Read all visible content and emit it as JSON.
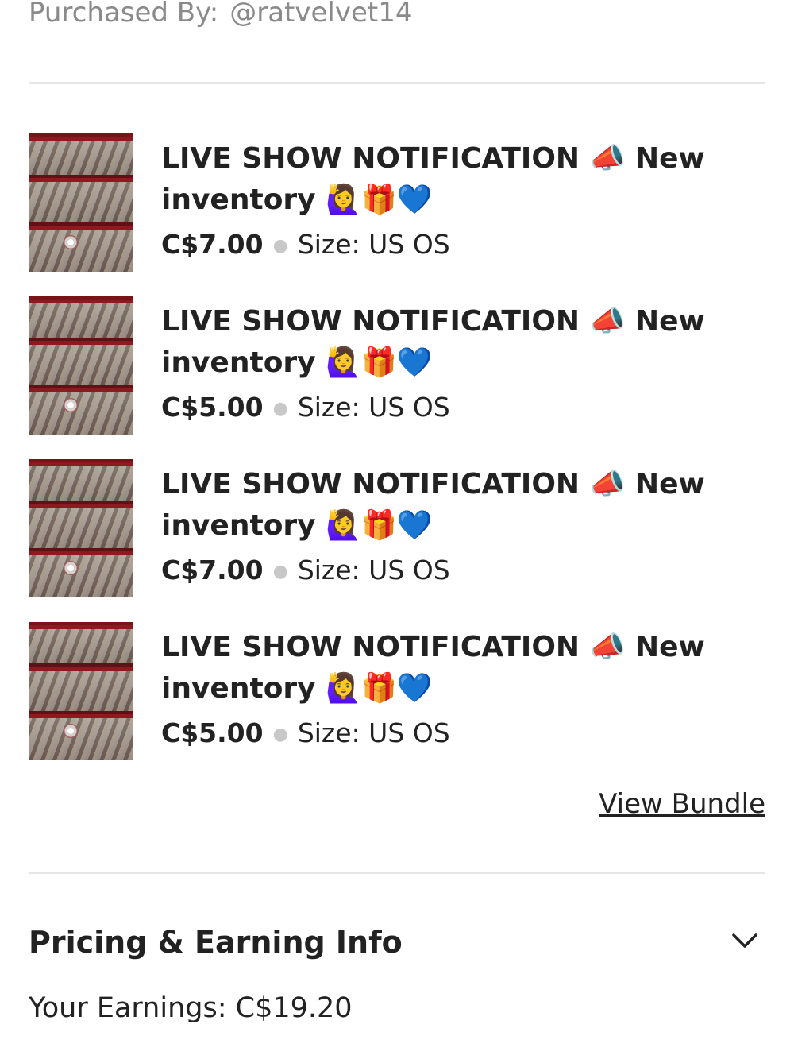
{
  "header": {
    "purchased_by_label": "Purchased By:",
    "purchased_by_user": "@ratvelvet14"
  },
  "items": [
    {
      "title": "LIVE SHOW NOTIFICATION",
      "title_emoji": "📣",
      "title_rest": "New inventory",
      "title_emojis_end": "🙋‍♀️🎁💙",
      "price": "C$7.00",
      "size": "Size: US OS"
    },
    {
      "title": "LIVE SHOW NOTIFICATION",
      "title_emoji": "📣",
      "title_rest": "New inventory",
      "title_emojis_end": "🙋‍♀️🎁💙",
      "price": "C$5.00",
      "size": "Size: US OS"
    },
    {
      "title": "LIVE SHOW NOTIFICATION",
      "title_emoji": "📣",
      "title_rest": "New inventory",
      "title_emojis_end": "🙋‍♀️🎁💙",
      "price": "C$7.00",
      "size": "Size: US OS"
    },
    {
      "title": "LIVE SHOW NOTIFICATION",
      "title_emoji": "📣",
      "title_rest": "New inventory",
      "title_emojis_end": "🙋‍♀️🎁💙",
      "price": "C$5.00",
      "size": "Size: US OS"
    }
  ],
  "bundle": {
    "view_bundle_label": "View Bundle"
  },
  "pricing": {
    "section_title": "Pricing & Earning Info",
    "expand_icon": "chevron-down-icon",
    "earnings_text": "Your Earnings: C$19.20"
  },
  "colors": {
    "text_primary": "#222222",
    "text_muted": "#8a8a8a",
    "divider": "#e6e6e6"
  }
}
